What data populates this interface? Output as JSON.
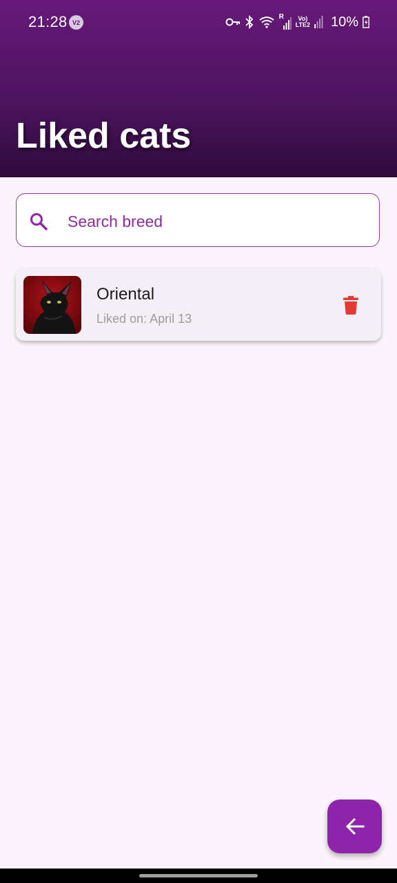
{
  "status_bar": {
    "time": "21:28",
    "volte_badge": "V2",
    "lte_top": "Vo)",
    "lte_bottom": "LTE2",
    "roaming": "R",
    "battery": "10%",
    "icons": [
      "key-icon",
      "bluetooth-icon",
      "wifi-icon",
      "signal-icon",
      "signal-icon",
      "battery-charging-icon"
    ]
  },
  "header": {
    "title": "Liked cats",
    "gradient_colors": [
      "#67197a",
      "#2f0b3c"
    ]
  },
  "search": {
    "placeholder": "Search breed",
    "value": "",
    "icon": "search-icon"
  },
  "liked_cats": [
    {
      "name": "Oriental",
      "liked_on": "Liked on: April 13",
      "delete_icon": "trash-icon"
    }
  ],
  "fab": {
    "icon": "arrow-left-icon"
  },
  "colors": {
    "accent": "#8e24aa",
    "background": "#fcf4fc",
    "delete": "#e53935",
    "placeholder": "#8a2d9c"
  }
}
